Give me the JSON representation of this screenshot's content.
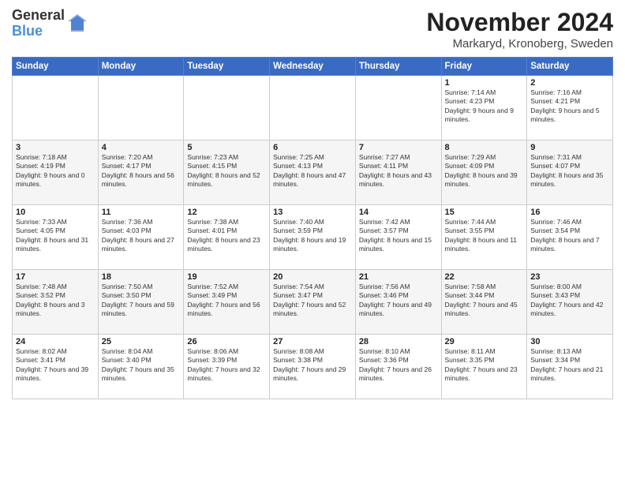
{
  "logo": {
    "general": "General",
    "blue": "Blue"
  },
  "title": "November 2024",
  "location": "Markaryd, Kronoberg, Sweden",
  "headers": [
    "Sunday",
    "Monday",
    "Tuesday",
    "Wednesday",
    "Thursday",
    "Friday",
    "Saturday"
  ],
  "weeks": [
    [
      {
        "day": "",
        "sunrise": "",
        "sunset": "",
        "daylight": ""
      },
      {
        "day": "",
        "sunrise": "",
        "sunset": "",
        "daylight": ""
      },
      {
        "day": "",
        "sunrise": "",
        "sunset": "",
        "daylight": ""
      },
      {
        "day": "",
        "sunrise": "",
        "sunset": "",
        "daylight": ""
      },
      {
        "day": "",
        "sunrise": "",
        "sunset": "",
        "daylight": ""
      },
      {
        "day": "1",
        "sunrise": "Sunrise: 7:14 AM",
        "sunset": "Sunset: 4:23 PM",
        "daylight": "Daylight: 9 hours and 9 minutes."
      },
      {
        "day": "2",
        "sunrise": "Sunrise: 7:16 AM",
        "sunset": "Sunset: 4:21 PM",
        "daylight": "Daylight: 9 hours and 5 minutes."
      }
    ],
    [
      {
        "day": "3",
        "sunrise": "Sunrise: 7:18 AM",
        "sunset": "Sunset: 4:19 PM",
        "daylight": "Daylight: 9 hours and 0 minutes."
      },
      {
        "day": "4",
        "sunrise": "Sunrise: 7:20 AM",
        "sunset": "Sunset: 4:17 PM",
        "daylight": "Daylight: 8 hours and 56 minutes."
      },
      {
        "day": "5",
        "sunrise": "Sunrise: 7:23 AM",
        "sunset": "Sunset: 4:15 PM",
        "daylight": "Daylight: 8 hours and 52 minutes."
      },
      {
        "day": "6",
        "sunrise": "Sunrise: 7:25 AM",
        "sunset": "Sunset: 4:13 PM",
        "daylight": "Daylight: 8 hours and 47 minutes."
      },
      {
        "day": "7",
        "sunrise": "Sunrise: 7:27 AM",
        "sunset": "Sunset: 4:11 PM",
        "daylight": "Daylight: 8 hours and 43 minutes."
      },
      {
        "day": "8",
        "sunrise": "Sunrise: 7:29 AM",
        "sunset": "Sunset: 4:09 PM",
        "daylight": "Daylight: 8 hours and 39 minutes."
      },
      {
        "day": "9",
        "sunrise": "Sunrise: 7:31 AM",
        "sunset": "Sunset: 4:07 PM",
        "daylight": "Daylight: 8 hours and 35 minutes."
      }
    ],
    [
      {
        "day": "10",
        "sunrise": "Sunrise: 7:33 AM",
        "sunset": "Sunset: 4:05 PM",
        "daylight": "Daylight: 8 hours and 31 minutes."
      },
      {
        "day": "11",
        "sunrise": "Sunrise: 7:36 AM",
        "sunset": "Sunset: 4:03 PM",
        "daylight": "Daylight: 8 hours and 27 minutes."
      },
      {
        "day": "12",
        "sunrise": "Sunrise: 7:38 AM",
        "sunset": "Sunset: 4:01 PM",
        "daylight": "Daylight: 8 hours and 23 minutes."
      },
      {
        "day": "13",
        "sunrise": "Sunrise: 7:40 AM",
        "sunset": "Sunset: 3:59 PM",
        "daylight": "Daylight: 8 hours and 19 minutes."
      },
      {
        "day": "14",
        "sunrise": "Sunrise: 7:42 AM",
        "sunset": "Sunset: 3:57 PM",
        "daylight": "Daylight: 8 hours and 15 minutes."
      },
      {
        "day": "15",
        "sunrise": "Sunrise: 7:44 AM",
        "sunset": "Sunset: 3:55 PM",
        "daylight": "Daylight: 8 hours and 11 minutes."
      },
      {
        "day": "16",
        "sunrise": "Sunrise: 7:46 AM",
        "sunset": "Sunset: 3:54 PM",
        "daylight": "Daylight: 8 hours and 7 minutes."
      }
    ],
    [
      {
        "day": "17",
        "sunrise": "Sunrise: 7:48 AM",
        "sunset": "Sunset: 3:52 PM",
        "daylight": "Daylight: 8 hours and 3 minutes."
      },
      {
        "day": "18",
        "sunrise": "Sunrise: 7:50 AM",
        "sunset": "Sunset: 3:50 PM",
        "daylight": "Daylight: 7 hours and 59 minutes."
      },
      {
        "day": "19",
        "sunrise": "Sunrise: 7:52 AM",
        "sunset": "Sunset: 3:49 PM",
        "daylight": "Daylight: 7 hours and 56 minutes."
      },
      {
        "day": "20",
        "sunrise": "Sunrise: 7:54 AM",
        "sunset": "Sunset: 3:47 PM",
        "daylight": "Daylight: 7 hours and 52 minutes."
      },
      {
        "day": "21",
        "sunrise": "Sunrise: 7:56 AM",
        "sunset": "Sunset: 3:46 PM",
        "daylight": "Daylight: 7 hours and 49 minutes."
      },
      {
        "day": "22",
        "sunrise": "Sunrise: 7:58 AM",
        "sunset": "Sunset: 3:44 PM",
        "daylight": "Daylight: 7 hours and 45 minutes."
      },
      {
        "day": "23",
        "sunrise": "Sunrise: 8:00 AM",
        "sunset": "Sunset: 3:43 PM",
        "daylight": "Daylight: 7 hours and 42 minutes."
      }
    ],
    [
      {
        "day": "24",
        "sunrise": "Sunrise: 8:02 AM",
        "sunset": "Sunset: 3:41 PM",
        "daylight": "Daylight: 7 hours and 39 minutes."
      },
      {
        "day": "25",
        "sunrise": "Sunrise: 8:04 AM",
        "sunset": "Sunset: 3:40 PM",
        "daylight": "Daylight: 7 hours and 35 minutes."
      },
      {
        "day": "26",
        "sunrise": "Sunrise: 8:06 AM",
        "sunset": "Sunset: 3:39 PM",
        "daylight": "Daylight: 7 hours and 32 minutes."
      },
      {
        "day": "27",
        "sunrise": "Sunrise: 8:08 AM",
        "sunset": "Sunset: 3:38 PM",
        "daylight": "Daylight: 7 hours and 29 minutes."
      },
      {
        "day": "28",
        "sunrise": "Sunrise: 8:10 AM",
        "sunset": "Sunset: 3:36 PM",
        "daylight": "Daylight: 7 hours and 26 minutes."
      },
      {
        "day": "29",
        "sunrise": "Sunrise: 8:11 AM",
        "sunset": "Sunset: 3:35 PM",
        "daylight": "Daylight: 7 hours and 23 minutes."
      },
      {
        "day": "30",
        "sunrise": "Sunrise: 8:13 AM",
        "sunset": "Sunset: 3:34 PM",
        "daylight": "Daylight: 7 hours and 21 minutes."
      }
    ]
  ]
}
